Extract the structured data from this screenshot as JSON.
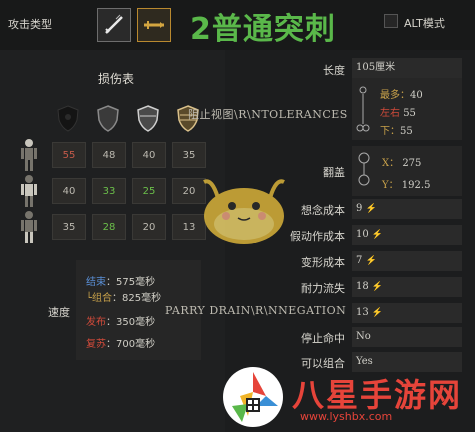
{
  "header": {
    "attack_type_label": "攻击类型",
    "title": "2普通突刺",
    "alt_mode_label": "ALT模式",
    "colors": {
      "title": "#5ab84a",
      "selected_border": "#b9892f"
    }
  },
  "damage_table": {
    "title": "损伤表",
    "armor_icons": [
      "armor-none-icon",
      "armor-light-icon",
      "armor-medium-icon",
      "armor-heavy-icon"
    ],
    "body_parts": [
      "head-icon",
      "torso-icon",
      "legs-icon"
    ],
    "rows": [
      [
        "55",
        "48",
        "40",
        "35"
      ],
      [
        "40",
        "33",
        "25",
        "20"
      ],
      [
        "35",
        "28",
        "20",
        "13"
      ]
    ],
    "colors": {
      "red": "#c45a4a",
      "green": "#6bbf4a",
      "plain": "#bcb9b0"
    }
  },
  "speed": {
    "label": "速度",
    "rows": [
      {
        "key": "结束",
        "sep": "：",
        "value": "575毫秒",
        "color": "#5a8fd6"
      },
      {
        "key": "└组合",
        "sep": "：",
        "value": "825毫秒",
        "color": "#c9a24a"
      },
      {
        "key": "发布",
        "sep": "：",
        "value": "350毫秒",
        "color": "#d04a3a"
      },
      {
        "key": "复苏",
        "sep": "：",
        "value": "700毫秒",
        "color": "#d04a3a"
      }
    ]
  },
  "stats": {
    "length_label": "长度",
    "length_value": "105厘米",
    "range_max_label": "最多：",
    "range_max_value": "40",
    "range_lr_label": "左右",
    "range_lr_value": "55",
    "range_down_label": "下：",
    "range_down_value": "55",
    "cover_label": "翻盖",
    "cover_x_label": "X：",
    "cover_x_value": "275",
    "cover_y_label": "Y：",
    "cover_y_value": "192.5",
    "thought_cost_label": "想念成本",
    "thought_cost_value": "9",
    "feint_cost_label": "假动作成本",
    "feint_cost_value": "10",
    "morph_cost_label": "变形成本",
    "morph_cost_value": "7",
    "stamina_drain_label": "耐力流失",
    "stamina_drain_value": "18",
    "parry_drain_value": "13",
    "stop_hit_label": "停止命中",
    "stop_hit_value": "No",
    "combo_label": "可以组合",
    "combo_value": "Yes"
  },
  "ghost_labels": {
    "tolerances": "阻止视图\\R\\NTOLERANCES",
    "parry_drain": "PARRY DRAIN\\R\\NNEGATION"
  },
  "watermark": {
    "text": "八星手游网",
    "url": "www.lyshbx.com"
  }
}
